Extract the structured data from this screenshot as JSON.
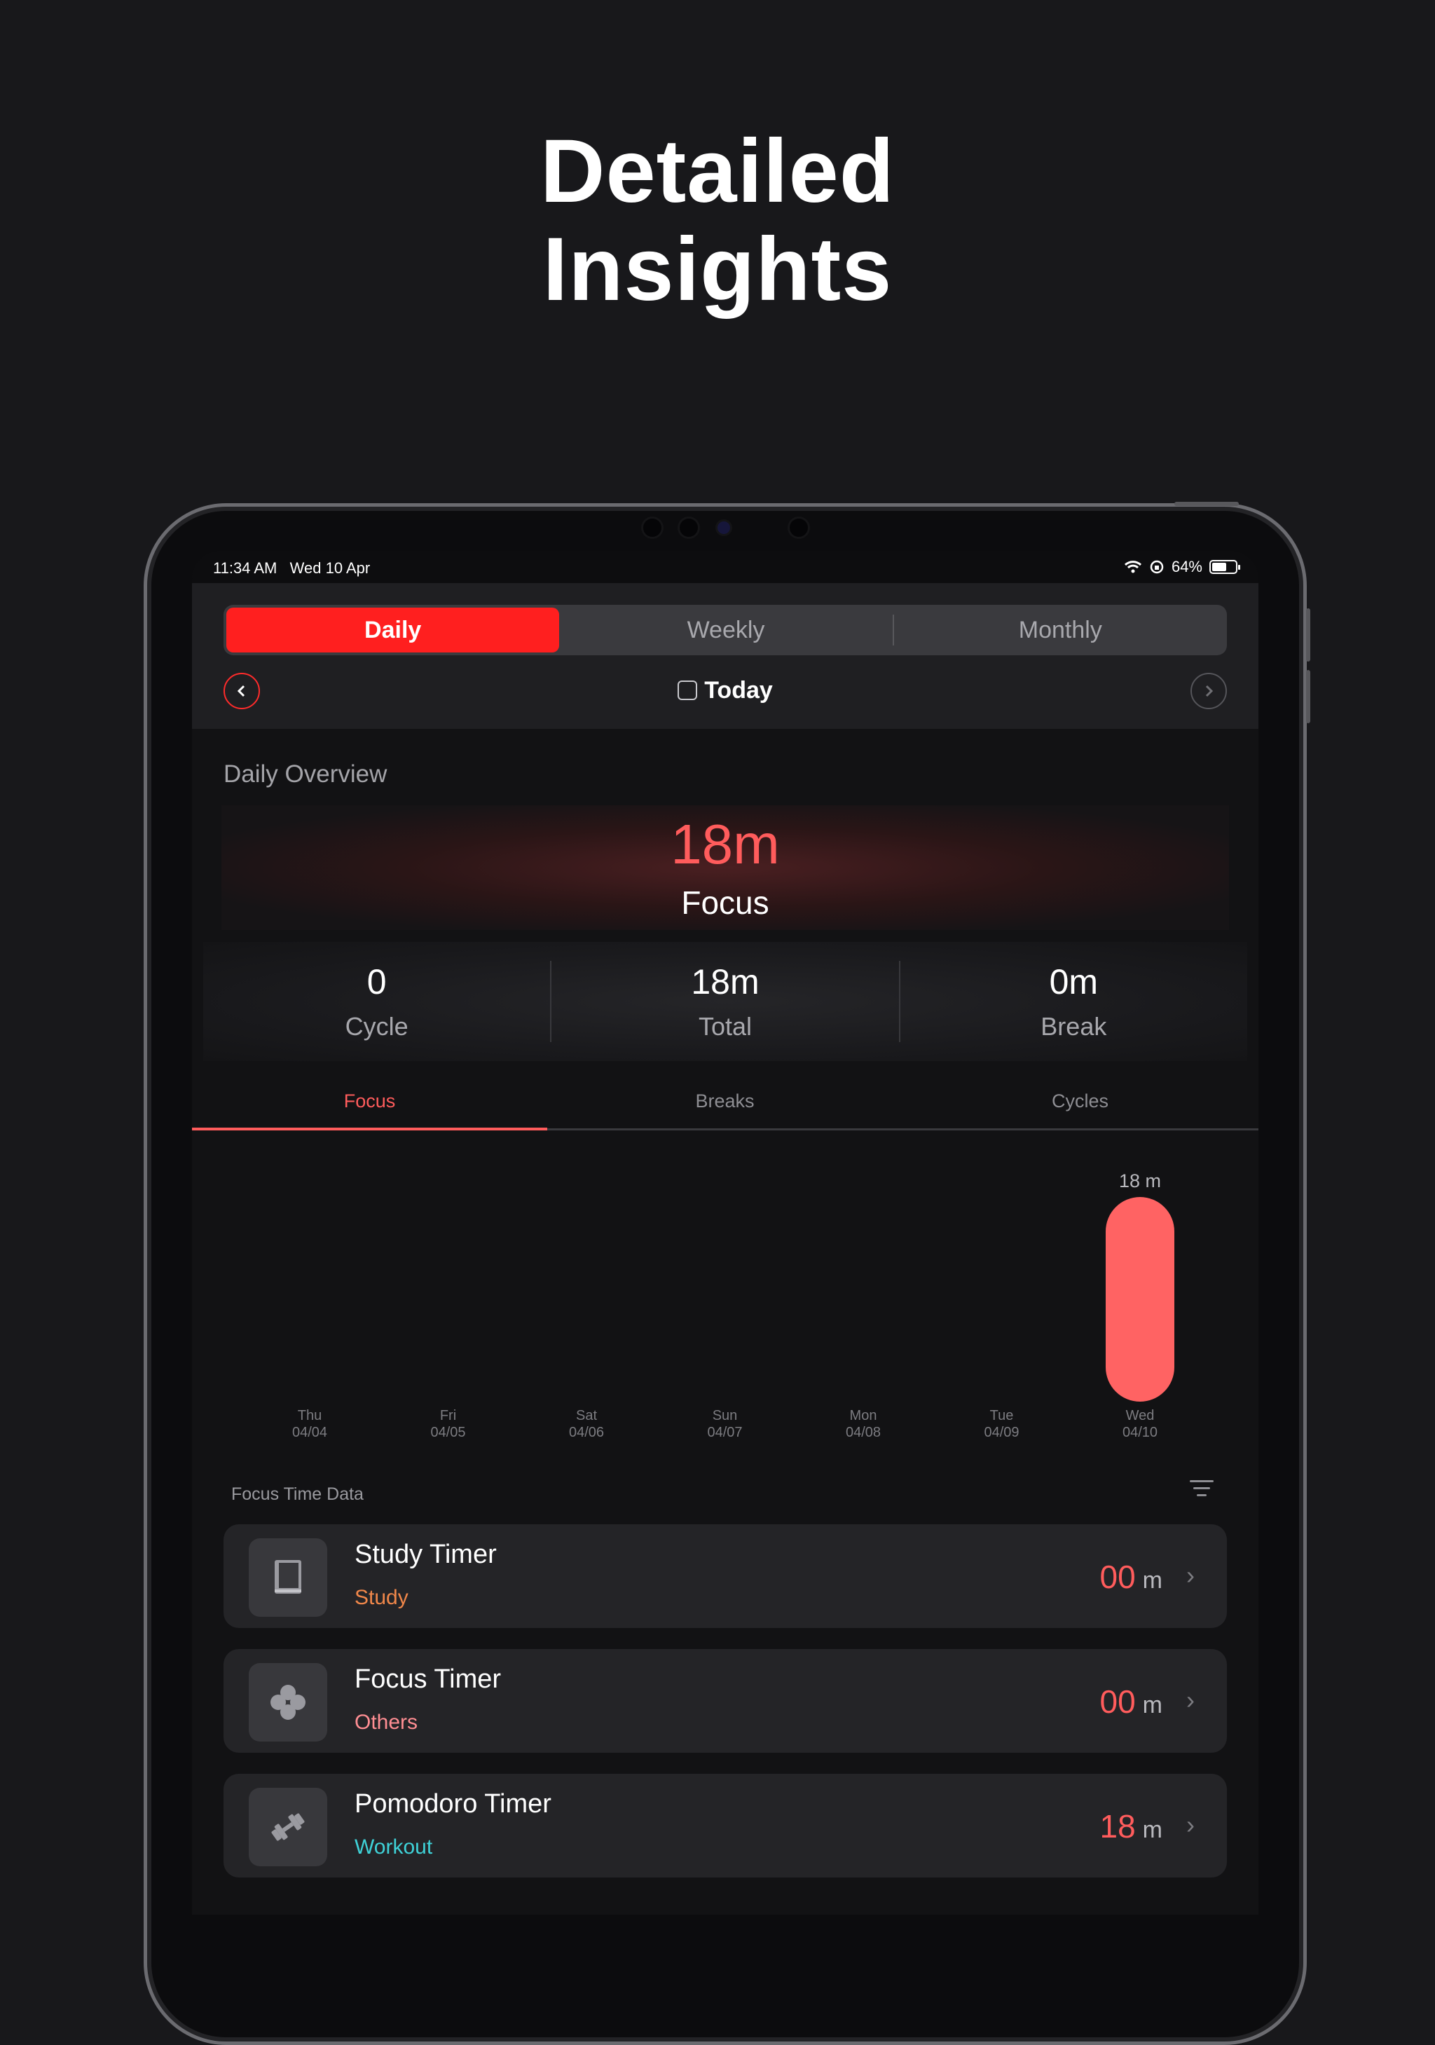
{
  "headline": {
    "line1": "Detailed",
    "line2": "Insights"
  },
  "status_bar": {
    "time": "11:34 AM",
    "date": "Wed 10 Apr",
    "battery": "64%",
    "battery_level": 0.64
  },
  "segment": {
    "items": [
      "Daily",
      "Weekly",
      "Monthly"
    ],
    "selected": "Daily"
  },
  "nav": {
    "title": "Today",
    "prev_icon": "chevron-left-icon",
    "next_icon": "chevron-right-icon"
  },
  "overview": {
    "title": "Daily Overview",
    "focus_value": "18m",
    "focus_label": "Focus",
    "stats": [
      {
        "value": "0",
        "label": "Cycle"
      },
      {
        "value": "18m",
        "label": "Total"
      },
      {
        "value": "0m",
        "label": "Break"
      }
    ]
  },
  "tabs": {
    "items": [
      "Focus",
      "Breaks",
      "Cycles"
    ],
    "selected": "Focus"
  },
  "chart_data": {
    "type": "bar",
    "categories": [
      "Thu 04/04",
      "Fri 04/05",
      "Sat 04/06",
      "Sun 04/07",
      "Mon 04/08",
      "Tue 04/09",
      "Wed 04/10"
    ],
    "day_names": [
      "Thu",
      "Fri",
      "Sat",
      "Sun",
      "Mon",
      "Tue",
      "Wed"
    ],
    "dates": [
      "04/04",
      "04/05",
      "04/06",
      "04/07",
      "04/08",
      "04/09",
      "04/10"
    ],
    "values": [
      0,
      0,
      0,
      0,
      0,
      0,
      18
    ],
    "value_labels": [
      "",
      "",
      "",
      "",
      "",
      "",
      "18 m"
    ],
    "bar_color": "#ff6363",
    "title": "",
    "xlabel": "",
    "ylabel": ""
  },
  "focus_time_data": {
    "title": "Focus Time Data",
    "items": [
      {
        "title": "Study Timer",
        "category": "Study",
        "category_color": "#f0874a",
        "value": "00",
        "unit": "m",
        "icon": "book-icon"
      },
      {
        "title": "Focus Timer",
        "category": "Others",
        "category_color": "#ff8e93",
        "value": "00",
        "unit": "m",
        "icon": "flower-icon"
      },
      {
        "title": "Pomodoro Timer",
        "category": "Workout",
        "category_color": "#3fd2d8",
        "value": "18",
        "unit": "m",
        "icon": "dumbbell-icon"
      }
    ]
  },
  "colors": {
    "accent": "#ff1f1f",
    "focus_value": "#ff5c5c",
    "background": "#18181b"
  }
}
